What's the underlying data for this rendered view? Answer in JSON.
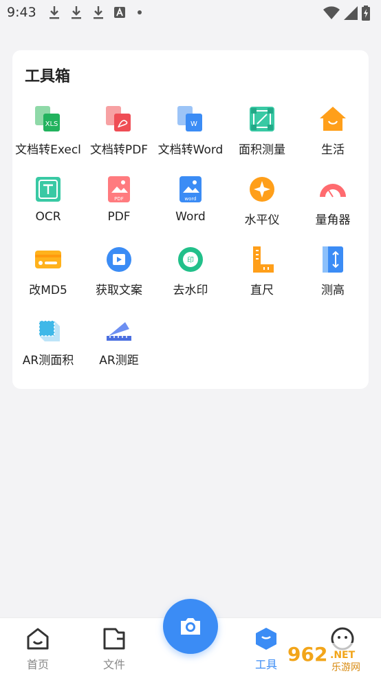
{
  "status_bar": {
    "time": "9:43"
  },
  "toolbox": {
    "title": "工具箱",
    "tools": [
      {
        "label": "文档转Execl",
        "icon": "doc-to-excel-icon"
      },
      {
        "label": "文档转PDF",
        "icon": "doc-to-pdf-icon"
      },
      {
        "label": "文档转Word",
        "icon": "doc-to-word-icon"
      },
      {
        "label": "面积测量",
        "icon": "area-measure-icon"
      },
      {
        "label": "生活",
        "icon": "life-home-icon"
      },
      {
        "label": "OCR",
        "icon": "ocr-icon"
      },
      {
        "label": "PDF",
        "icon": "pdf-icon"
      },
      {
        "label": "Word",
        "icon": "word-icon"
      },
      {
        "label": "水平仪",
        "icon": "level-icon"
      },
      {
        "label": "量角器",
        "icon": "protractor-icon"
      },
      {
        "label": "改MD5",
        "icon": "md5-card-icon"
      },
      {
        "label": "获取文案",
        "icon": "get-copy-icon"
      },
      {
        "label": "去水印",
        "icon": "remove-watermark-icon"
      },
      {
        "label": "直尺",
        "icon": "ruler-icon"
      },
      {
        "label": "测高",
        "icon": "height-measure-icon"
      },
      {
        "label": "AR测面积",
        "icon": "ar-area-icon"
      },
      {
        "label": "AR测距",
        "icon": "ar-distance-icon"
      }
    ]
  },
  "bottom_nav": {
    "home": "首页",
    "files": "文件",
    "tools": "工具",
    "active": "工具"
  },
  "watermark": {
    "text": "962",
    "suffix": ".NET",
    "sub": "乐游网"
  },
  "colors": {
    "accent": "#3b8cf5",
    "background": "#f3f3f5"
  }
}
